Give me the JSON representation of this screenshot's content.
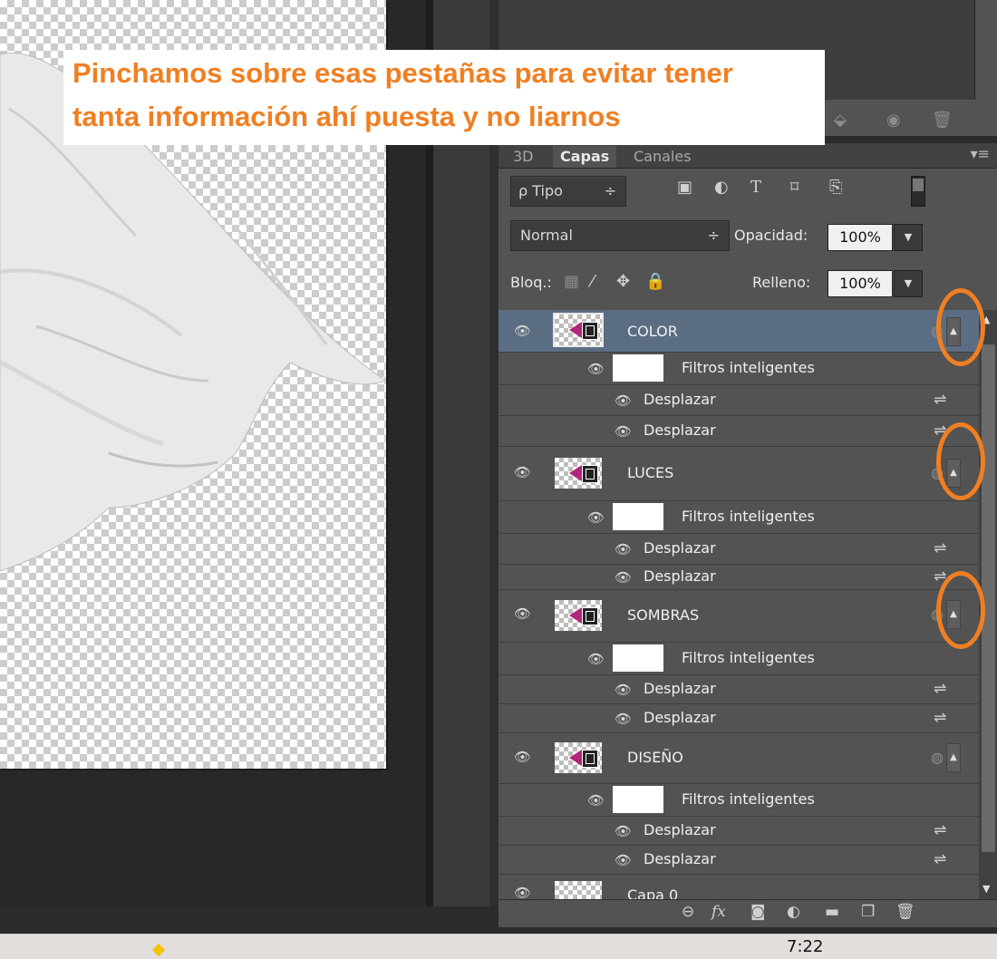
{
  "annotation": {
    "line1": "Pinchamos sobre esas pestañas para evitar tener",
    "line2": "tanta información ahí puesta y no liarnos",
    "color": "#f07f22"
  },
  "tabs": [
    {
      "label": "3D"
    },
    {
      "label": "Capas"
    },
    {
      "label": "Canales"
    }
  ],
  "filter": {
    "select_label": "ρ Tipo",
    "select_arrow": "÷"
  },
  "blend": {
    "mode": "Normal",
    "arrow": "÷",
    "opacity_label": "Opacidad:",
    "opacity_value": "100%"
  },
  "lock": {
    "label": "Bloq.:",
    "fill_label": "Relleno:",
    "fill_value": "100%"
  },
  "layers": [
    {
      "name": "COLOR",
      "smart_filters": "Filtros inteligentes",
      "filters": [
        "Desplazar",
        "Desplazar"
      ]
    },
    {
      "name": "LUCES",
      "smart_filters": "Filtros inteligentes",
      "filters": [
        "Desplazar",
        "Desplazar"
      ]
    },
    {
      "name": "SOMBRAS",
      "smart_filters": "Filtros inteligentes",
      "filters": [
        "Desplazar",
        "Desplazar"
      ]
    },
    {
      "name": "DISEÑO",
      "smart_filters": "Filtros inteligentes",
      "filters": [
        "Desplazar",
        "Desplazar"
      ]
    },
    {
      "name": "Capa 0"
    }
  ],
  "bottom_icons": {
    "fx": "fx"
  },
  "taskbar": {
    "clock": "7:22"
  },
  "colors": {
    "panel_bg": "#535353",
    "selected_row": "#5b6d82",
    "highlight": "#f07f22"
  }
}
